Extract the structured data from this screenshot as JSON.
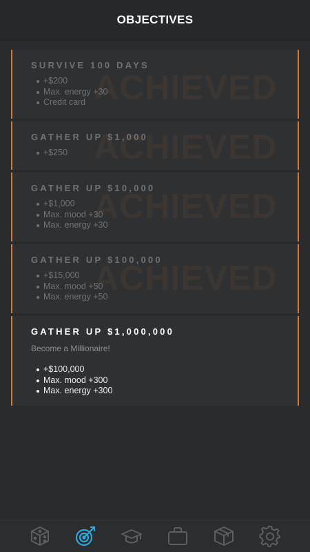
{
  "header": {
    "title": "OBJECTIVES"
  },
  "objectives": [
    {
      "title": "SURVIVE 100 DAYS",
      "status": "ACHIEVED",
      "rewards": [
        "+$200",
        "Max. energy +30",
        "Credit card"
      ]
    },
    {
      "title": "GATHER UP $1,000",
      "status": "ACHIEVED",
      "rewards": [
        "+$250"
      ]
    },
    {
      "title": "GATHER UP $10,000",
      "status": "ACHIEVED",
      "rewards": [
        "+$1,000",
        "Max. mood +30",
        "Max. energy +30"
      ]
    },
    {
      "title": "GATHER UP $100,000",
      "status": "ACHIEVED",
      "rewards": [
        "+$15,000",
        "Max. mood +50",
        "Max. energy +50"
      ]
    },
    {
      "title": "GATHER UP $1,000,000",
      "subtitle": "Become a Millionaire!",
      "rewards": [
        "+$100,000",
        "Max. mood +300",
        "Max. energy +300"
      ]
    }
  ],
  "tabs": [
    {
      "icon": "cube-icon",
      "active": false
    },
    {
      "icon": "target-icon",
      "active": true
    },
    {
      "icon": "graduation-cap-icon",
      "active": false
    },
    {
      "icon": "briefcase-icon",
      "active": false
    },
    {
      "icon": "box-icon",
      "active": false
    },
    {
      "icon": "gear-icon",
      "active": false
    }
  ],
  "colors": {
    "accent": "#d9773a",
    "active_tab": "#2aa9e0",
    "inactive_tab": "#5d5e61"
  }
}
